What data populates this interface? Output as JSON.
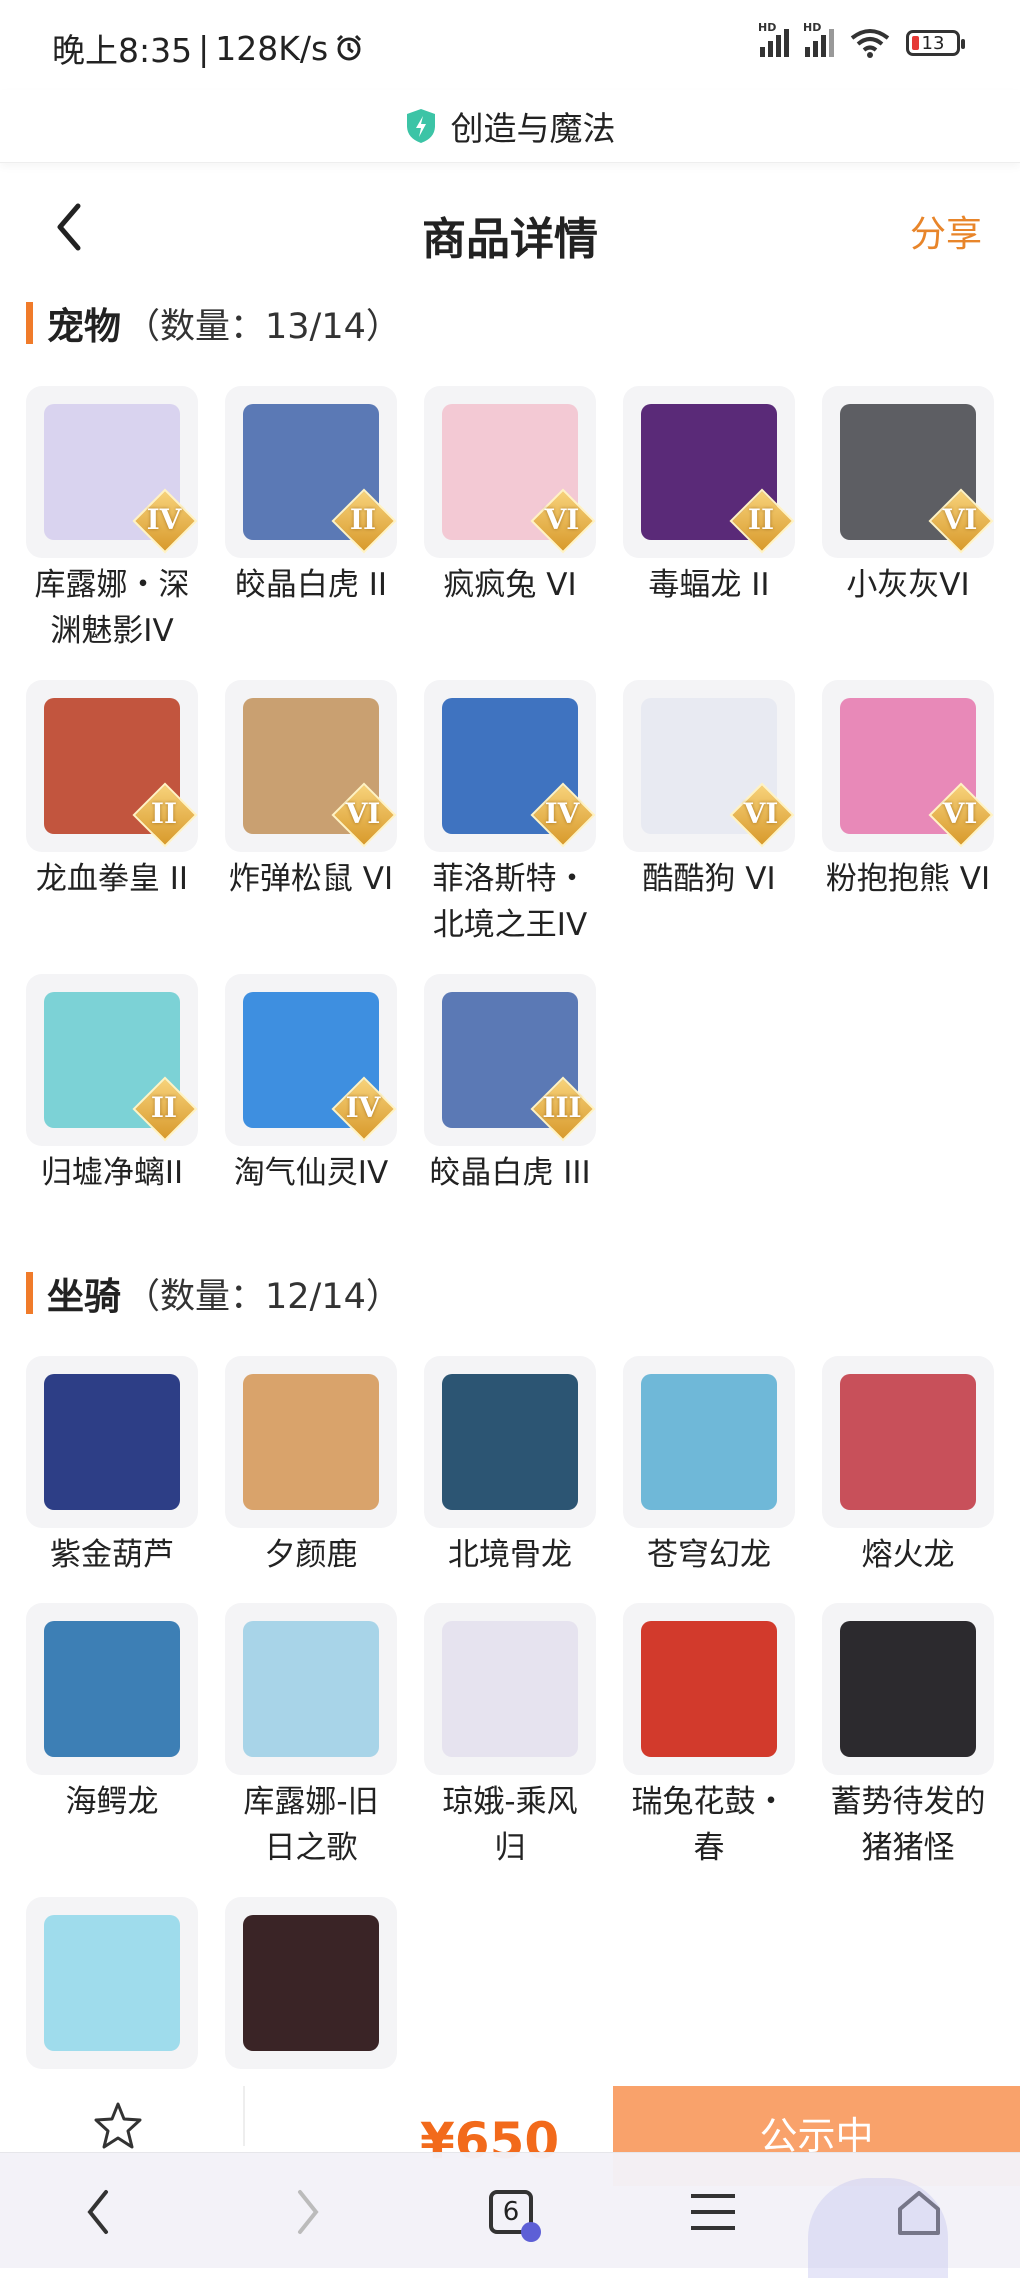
{
  "status_bar": {
    "time": "晚上8:35",
    "speed": "128K/s",
    "battery": "13",
    "signal_label": "HD"
  },
  "browser": {
    "site_title": "创造与魔法",
    "tab_count": "6"
  },
  "header": {
    "title": "商品详情",
    "share_label": "分享"
  },
  "pets": {
    "title": "宠物",
    "count_label": "（数量：13/14）",
    "items": [
      {
        "name": "库露娜・深渊魅影IV",
        "line1": "库露娜・深",
        "line2": "渊魅影IV",
        "tier": "IV",
        "color": "#d9d3ef"
      },
      {
        "name": "皎晶白虎 II",
        "line1": "皎晶白虎 II",
        "line2": "",
        "tier": "II",
        "color": "#5b79b5"
      },
      {
        "name": "疯疯兔 VI",
        "line1": "疯疯兔 VI",
        "line2": "",
        "tier": "VI",
        "color": "#f3c9d4"
      },
      {
        "name": "毒蝠龙 II",
        "line1": "毒蝠龙 II",
        "line2": "",
        "tier": "II",
        "color": "#5a2a78"
      },
      {
        "name": "小灰灰VI",
        "line1": "小灰灰VI",
        "line2": "",
        "tier": "VI",
        "color": "#5d5e63"
      },
      {
        "name": "龙血拳皇 II",
        "line1": "龙血拳皇 II",
        "line2": "",
        "tier": "II",
        "color": "#c2553e"
      },
      {
        "name": "炸弹松鼠 VI",
        "line1": "炸弹松鼠 VI",
        "line2": "",
        "tier": "VI",
        "color": "#c9a071"
      },
      {
        "name": "菲洛斯特・北境之王IV",
        "line1": "菲洛斯特・",
        "line2": "北境之王IV",
        "tier": "IV",
        "color": "#3f73c0"
      },
      {
        "name": "酷酷狗 VI",
        "line1": "酷酷狗 VI",
        "line2": "",
        "tier": "VI",
        "color": "#e8eaf2"
      },
      {
        "name": "粉抱抱熊 VI",
        "line1": "粉抱抱熊 VI",
        "line2": "",
        "tier": "VI",
        "color": "#e889b8"
      },
      {
        "name": "归墟净螭II",
        "line1": "归墟净螭II",
        "line2": "",
        "tier": "II",
        "color": "#7cd2d6"
      },
      {
        "name": "淘气仙灵IV",
        "line1": "淘气仙灵IV",
        "line2": "",
        "tier": "IV",
        "color": "#3e8fe0"
      },
      {
        "name": "皎晶白虎 III",
        "line1": "皎晶白虎 III",
        "line2": "",
        "tier": "III",
        "color": "#5b79b5"
      }
    ]
  },
  "mounts": {
    "title": "坐骑",
    "count_label": "（数量：12/14）",
    "items": [
      {
        "name": "紫金葫芦",
        "line1": "紫金葫芦",
        "line2": "",
        "color": "#2d3e86"
      },
      {
        "name": "夕颜鹿",
        "line1": "夕颜鹿",
        "line2": "",
        "color": "#d9a36b"
      },
      {
        "name": "北境骨龙",
        "line1": "北境骨龙",
        "line2": "",
        "color": "#2c5573"
      },
      {
        "name": "苍穹幻龙",
        "line1": "苍穹幻龙",
        "line2": "",
        "color": "#6fb8d8"
      },
      {
        "name": "熔火龙",
        "line1": "熔火龙",
        "line2": "",
        "color": "#c8505a"
      },
      {
        "name": "海鳄龙",
        "line1": "海鳄龙",
        "line2": "",
        "color": "#3d7fb5"
      },
      {
        "name": "库露娜-旧日之歌",
        "line1": "库露娜-旧",
        "line2": "日之歌",
        "color": "#a8d4e8"
      },
      {
        "name": "琼娥-乘风归",
        "line1": "琼娥-乘风",
        "line2": "归",
        "color": "#e6e3ef"
      },
      {
        "name": "瑞兔花鼓・春",
        "line1": "瑞兔花鼓・",
        "line2": "春",
        "color": "#d23a2c"
      },
      {
        "name": "蓄势待发的猪猪怪",
        "line1": "蓄势待发的",
        "line2": "猪猪怪",
        "color": "#2c2a2e"
      },
      {
        "name": "",
        "line1": "",
        "line2": "",
        "color": "#9fdcec"
      },
      {
        "name": "",
        "line1": "",
        "line2": "",
        "color": "#3a2426"
      }
    ]
  },
  "purchase": {
    "price": "¥650",
    "action_label": "公示中"
  },
  "icons": {
    "back": "chevron-left-icon",
    "share": "share-label",
    "fav": "star-icon",
    "nav_back": "chevron-left-icon",
    "nav_forward": "chevron-right-icon",
    "menu": "menu-icon",
    "home": "home-icon"
  },
  "colors": {
    "accent": "#f07b2a",
    "share": "#e8852a",
    "price": "#f26a1b",
    "action_bg": "#f9a26b"
  }
}
